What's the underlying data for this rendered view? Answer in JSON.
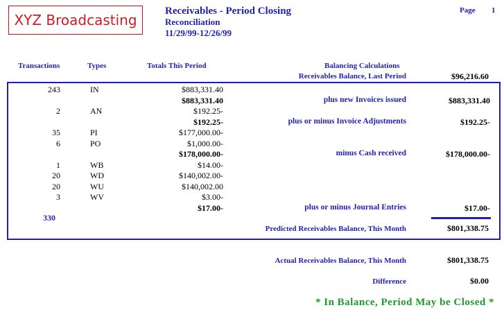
{
  "header": {
    "logo_text": "XYZ Broadcasting",
    "title": "Receivables - Period Closing",
    "subtitle": "Reconciliation",
    "period": "11/29/99-12/26/99",
    "page_label": "Page",
    "page_number": "1"
  },
  "columns": {
    "transactions": "Transactions",
    "types": "Types",
    "totals": "Totals This Period",
    "balancing": "Balancing Calculations"
  },
  "opening": {
    "label": "Receivables Balance, Last Period",
    "value": "$96,216.60"
  },
  "rows": [
    {
      "count": "243",
      "type": "IN",
      "amount": "$883,331.40",
      "bold": false,
      "label": "",
      "value": ""
    },
    {
      "count": "",
      "type": "",
      "amount": "$883,331.40",
      "bold": true,
      "label": "plus new Invoices issued",
      "value": "$883,331.40"
    },
    {
      "count": "2",
      "type": "AN",
      "amount": "$192.25-",
      "bold": false,
      "label": "",
      "value": ""
    },
    {
      "count": "",
      "type": "",
      "amount": "$192.25-",
      "bold": true,
      "label": "plus or minus Invoice Adjustments",
      "value": "$192.25-"
    },
    {
      "count": "35",
      "type": "PI",
      "amount": "$177,000.00-",
      "bold": false,
      "label": "",
      "value": ""
    },
    {
      "count": "6",
      "type": "PO",
      "amount": "$1,000.00-",
      "bold": false,
      "label": "",
      "value": ""
    },
    {
      "count": "",
      "type": "",
      "amount": "$178,000.00-",
      "bold": true,
      "label": "minus Cash received",
      "value": "$178,000.00-"
    },
    {
      "count": "1",
      "type": "WB",
      "amount": "$14.00-",
      "bold": false,
      "label": "",
      "value": ""
    },
    {
      "count": "20",
      "type": "WD",
      "amount": "$140,002.00-",
      "bold": false,
      "label": "",
      "value": ""
    },
    {
      "count": "20",
      "type": "WU",
      "amount": "$140,002.00",
      "bold": false,
      "label": "",
      "value": ""
    },
    {
      "count": "3",
      "type": "WV",
      "amount": "$3.00-",
      "bold": false,
      "label": "",
      "value": ""
    },
    {
      "count": "",
      "type": "",
      "amount": "$17.00-",
      "bold": true,
      "label": "plus or minus Journal Entries",
      "value": "$17.00-"
    }
  ],
  "total_count": "330",
  "predicted": {
    "label": "Predicted Receivables Balance, This Month",
    "value": "$801,338.75"
  },
  "actual": {
    "label": "Actual Receivables Balance, This Month",
    "value": "$801,338.75"
  },
  "difference": {
    "label": "Difference",
    "value": "$0.00"
  },
  "status": "* In Balance, Period May be Closed *",
  "colors": {
    "heading_blue": "#1f1fb4",
    "logo_red": "#d41a24",
    "status_green": "#1d9a2a"
  }
}
